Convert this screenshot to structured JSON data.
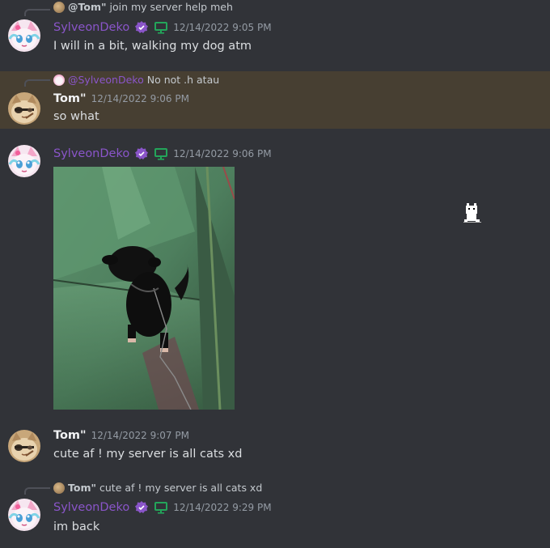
{
  "colors": {
    "background": "#313338",
    "highlight": "#473f32",
    "sylveon_name": "#8a55c9",
    "tom_name": "#f2f3f5",
    "timestamp": "#949ba4",
    "monitor_icon": "#23a55a"
  },
  "messages": [
    {
      "reply": {
        "name": "@Tom\"",
        "text": "join my server help meh"
      },
      "author": "SylveonDeko",
      "timestamp": "12/14/2022 9:05 PM",
      "text": "I will in a bit, walking my dog atm"
    },
    {
      "reply": {
        "name": "@SylveonDeko",
        "text": "No not .h atau"
      },
      "author": "Tom\"",
      "timestamp": "12/14/2022 9:06 PM",
      "text": "so what"
    },
    {
      "author": "SylveonDeko",
      "timestamp": "12/14/2022 9:06 PM",
      "attachment_icon": "dog-photo"
    },
    {
      "author": "Tom\"",
      "timestamp": "12/14/2022 9:07 PM",
      "text": "cute af ! my server is all cats xd"
    },
    {
      "reply": {
        "name": "Tom\"",
        "text": "cute af ! my server is all cats xd"
      },
      "author": "SylveonDeko",
      "timestamp": "12/14/2022 9:29 PM",
      "text": "im back"
    }
  ]
}
